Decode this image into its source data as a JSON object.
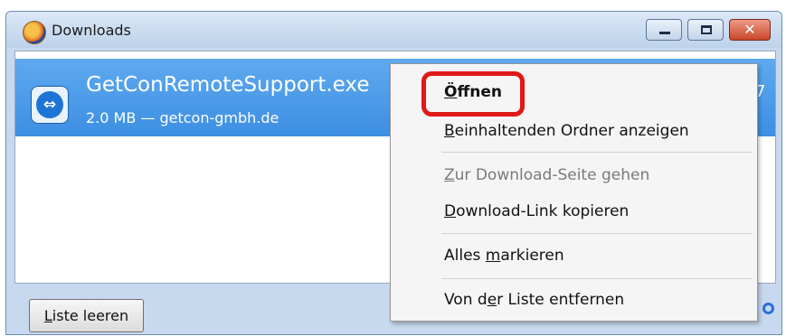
{
  "window": {
    "title": "Downloads",
    "controls": {
      "close_glyph": "✕"
    }
  },
  "download": {
    "file_name": "GetConRemoteSupport.exe",
    "meta": "2.0 MB — getcon-gmbh.de",
    "cut_text": "7"
  },
  "footer": {
    "clear_button": "Liste leeren"
  },
  "context_menu": {
    "items": [
      {
        "pre": "",
        "ul": "Ö",
        "post": "ffnen",
        "bold": true,
        "enabled": true
      },
      {
        "pre": "",
        "ul": "B",
        "post": "einhaltenden Ordner anzeigen",
        "bold": false,
        "enabled": true
      },
      {
        "pre": "",
        "ul": "Z",
        "post": "ur Download-Seite gehen",
        "bold": false,
        "enabled": false
      },
      {
        "pre": "",
        "ul": "D",
        "post": "ownload-Link kopieren",
        "bold": false,
        "enabled": true
      },
      {
        "pre": "Alles ",
        "ul": "m",
        "post": "arkieren",
        "bold": false,
        "enabled": true
      },
      {
        "pre": "Von d",
        "ul": "e",
        "post": "r Liste entfernen",
        "bold": false,
        "enabled": true
      }
    ]
  },
  "icons": [
    "firefox-icon",
    "minimize-icon",
    "maximize-icon",
    "close-icon",
    "teamviewer-file-icon",
    "search-icon"
  ],
  "colors": {
    "selection": "#3d8fe3",
    "highlight_ring": "#e01818"
  }
}
